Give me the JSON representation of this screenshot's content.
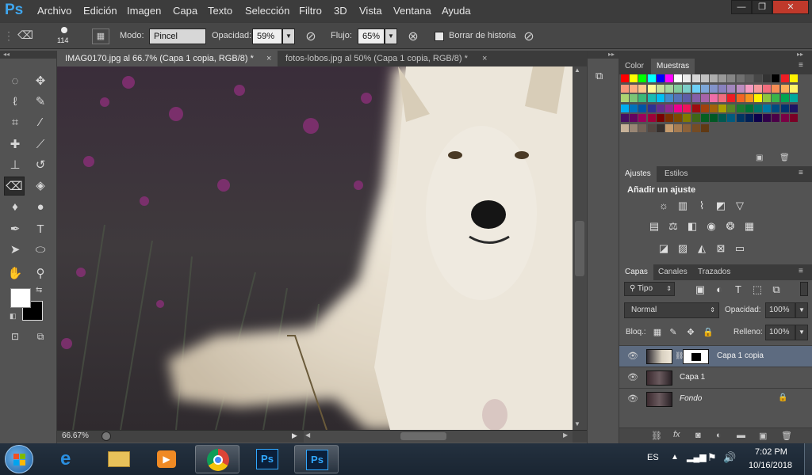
{
  "app": {
    "logo": "Ps"
  },
  "menu": [
    "Archivo",
    "Edición",
    "Imagen",
    "Capa",
    "Texto",
    "Selección",
    "Filtro",
    "3D",
    "Vista",
    "Ventana",
    "Ayuda"
  ],
  "window_controls": {
    "minimize": "—",
    "restore": "❐",
    "close": "✕"
  },
  "options": {
    "brush_size": "114",
    "mode_label": "Modo:",
    "mode_value": "Pincel",
    "opacity_label": "Opacidad:",
    "opacity_value": "59%",
    "flow_label": "Flujo:",
    "flow_value": "65%",
    "erase_history_label": "Borrar de historia"
  },
  "document_tabs": [
    {
      "label": "IMAG0170.jpg al 66.7% (Capa 1 copia, RGB/8) *",
      "active": true
    },
    {
      "label": "fotos-lobos.jpg al 50% (Capa 1 copia, RGB/8) *",
      "active": false
    }
  ],
  "status": {
    "zoom": "66.67%"
  },
  "swatches_panel": {
    "tabs": [
      "Color",
      "Muestras"
    ],
    "rows": [
      [
        "#ff0000",
        "#ffff00",
        "#00ff00",
        "#00ffff",
        "#0000ff",
        "#ff00ff",
        "#ffffff",
        "#ebebeb",
        "#d6d6d6",
        "#c2c2c2",
        "#adadad",
        "#999999",
        "#858585",
        "#707070",
        "#5c5c5c",
        "#474747",
        "#333333",
        "#000000",
        "#ee1d24",
        "#fff200"
      ],
      [
        "#f7977a",
        "#fbad82",
        "#fdc68c",
        "#fff799",
        "#c6df9c",
        "#a4d49d",
        "#81ca9d",
        "#7bcdc9",
        "#6ccff7",
        "#7ca6d8",
        "#8293ca",
        "#8881be",
        "#a286bd",
        "#bc8cbf",
        "#f49bc1",
        "#f5999d",
        "#f26d7d",
        "#f68e55",
        "#fbaf5a",
        "#fff467"
      ],
      [
        "#acd372",
        "#7cc576",
        "#3bb878",
        "#1abbb4",
        "#00bff3",
        "#438ccb",
        "#5573b7",
        "#5e5ca7",
        "#855fa8",
        "#a763a9",
        "#ef6ea8",
        "#f16d7e",
        "#ed1c24",
        "#f26522",
        "#f7941d",
        "#fff200",
        "#8dc63f",
        "#39b54a",
        "#00a651",
        "#00a99d"
      ],
      [
        "#00aeef",
        "#0072bc",
        "#0054a5",
        "#2e3192",
        "#652d90",
        "#92278f",
        "#ec008c",
        "#ed145b",
        "#9e0b0f",
        "#a0410d",
        "#a36209",
        "#aba000",
        "#598527",
        "#1a7b30",
        "#007236",
        "#00746b",
        "#0076a4",
        "#004a80",
        "#003370",
        "#1d1363"
      ],
      [
        "#450e61",
        "#630460",
        "#9b005c",
        "#9e0039",
        "#790000",
        "#7b2e00",
        "#7d4900",
        "#827a00",
        "#3e6617",
        "#045f20",
        "#005824",
        "#005951",
        "#005b7e",
        "#003562",
        "#002056",
        "#0c004b",
        "#30004a",
        "#4b0048",
        "#7a0045",
        "#7a0026"
      ],
      [
        "#c7b299",
        "#998675",
        "#736357",
        "#534741",
        "#37302d",
        "#c69c6e",
        "#a67c52",
        "#8c6239",
        "#754c24",
        "#603913"
      ]
    ]
  },
  "adjust_panel": {
    "tabs": [
      "Ajustes",
      "Estilos"
    ],
    "title": "Añadir un ajuste",
    "icons": [
      [
        "brightness-icon",
        "levels-icon",
        "curves-icon",
        "exposure-icon",
        "vibrance-icon"
      ],
      [
        "hue-saturation-icon",
        "color-balance-icon",
        "black-white-icon",
        "photo-filter-icon",
        "channel-mixer-icon",
        "color-lookup-icon"
      ],
      [
        "invert-icon",
        "posterize-icon",
        "threshold-icon",
        "selective-color-icon",
        "gradient-map-icon"
      ]
    ]
  },
  "layers_panel": {
    "tabs": [
      "Capas",
      "Canales",
      "Trazados"
    ],
    "filter_kind": "Tipo",
    "blend_mode": "Normal",
    "opacity_label": "Opacidad:",
    "opacity_value": "100%",
    "lock_label": "Bloq.:",
    "fill_label": "Relleno:",
    "fill_value": "100%",
    "layers": [
      {
        "name": "Capa 1 copia",
        "selected": true,
        "mask": true,
        "italic": false
      },
      {
        "name": "Capa 1",
        "selected": false,
        "mask": false,
        "italic": false
      },
      {
        "name": "Fondo",
        "selected": false,
        "mask": false,
        "italic": true,
        "locked": true
      }
    ]
  },
  "taskbar": {
    "apps": [
      "start-button",
      "internet-explorer",
      "file-explorer",
      "media-player",
      "chrome",
      "photoshop",
      "photoshop"
    ],
    "language": "ES",
    "time": "7:02 PM",
    "date": "10/16/2018"
  }
}
